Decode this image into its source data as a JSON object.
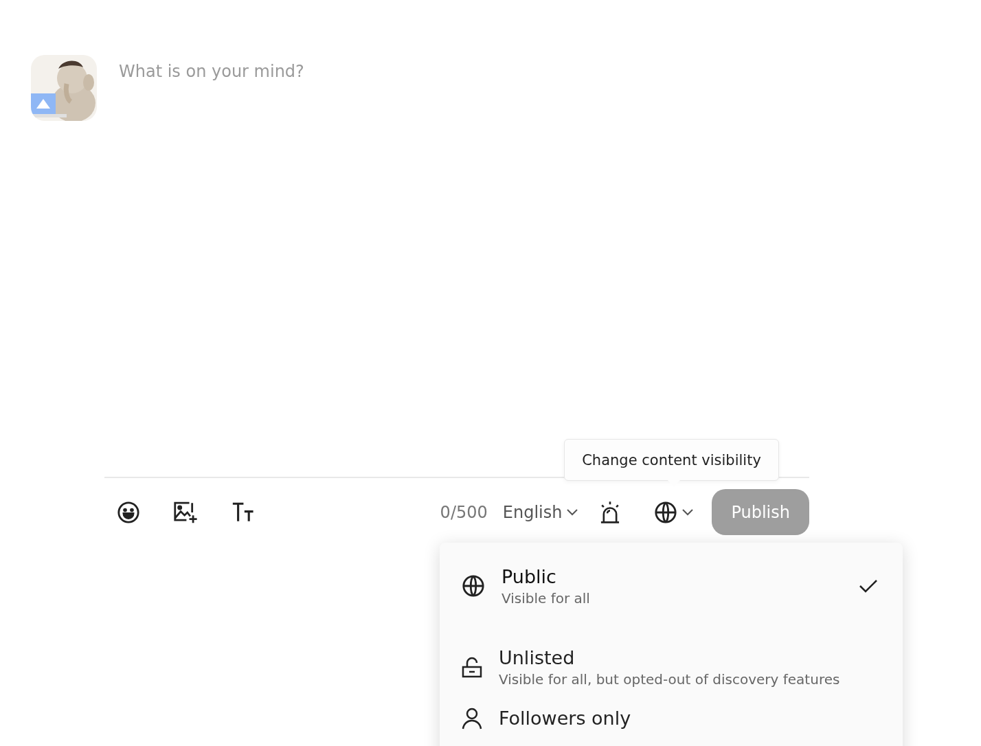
{
  "composer": {
    "placeholder": "What is on your mind?"
  },
  "toolbar": {
    "counter": "0/500",
    "language": "English",
    "publish": "Publish"
  },
  "tooltip": "Change content visibility",
  "visibility_menu": [
    {
      "kind": "public",
      "title": "Public",
      "description": "Visible for all",
      "selected": true
    },
    {
      "kind": "unlisted",
      "title": "Unlisted",
      "description": "Visible for all, but opted-out of discovery features",
      "selected": false
    },
    {
      "kind": "followers",
      "title": "Followers only",
      "selected": false
    }
  ]
}
